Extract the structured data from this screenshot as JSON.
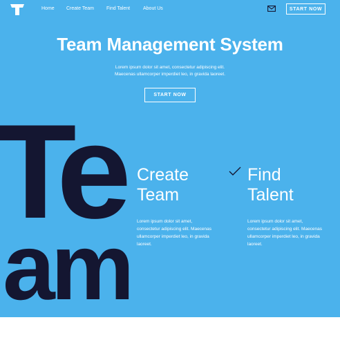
{
  "nav": {
    "items": [
      {
        "label": "Home"
      },
      {
        "label": "Create Team"
      },
      {
        "label": "Find Talent"
      },
      {
        "label": "About Us"
      }
    ],
    "cta_label": "START NOW"
  },
  "icons": {
    "logo": "logo-t-icon",
    "mail": "mail-icon",
    "check": "check-icon"
  },
  "hero": {
    "title": "Team Management System",
    "description_line1": "Lorem ipsum dolor sit amet, consectetur adipiscing elit.",
    "description_line2": "Maecenas ullamcorper imperdiet leo, in gravida laoreet.",
    "cta_label": "START NOW",
    "big_word_top": "Te",
    "big_word_bottom": "am"
  },
  "features": [
    {
      "title_line1": "Create",
      "title_line2": "Team",
      "text_line1": "Lorem ipsum dolor sit amet,",
      "text_line2": "consectetur adipiscing elit. Maecenas",
      "text_line3": "ullamcorper imperdiet leo, in gravida",
      "text_line4": "laoreet."
    },
    {
      "title_line1": "Find",
      "title_line2": "Talent",
      "text_line1": "Lorem ipsum dolor sit amet,",
      "text_line2": "consectetur adipiscing elit. Maecenas",
      "text_line3": "ullamcorper imperdiet leo, in gravida",
      "text_line4": "laoreet."
    }
  ],
  "colors": {
    "hero_background": "#4bb2ec",
    "big_word": "#141631",
    "text": "#ffffff",
    "page_background": "#ffffff"
  }
}
